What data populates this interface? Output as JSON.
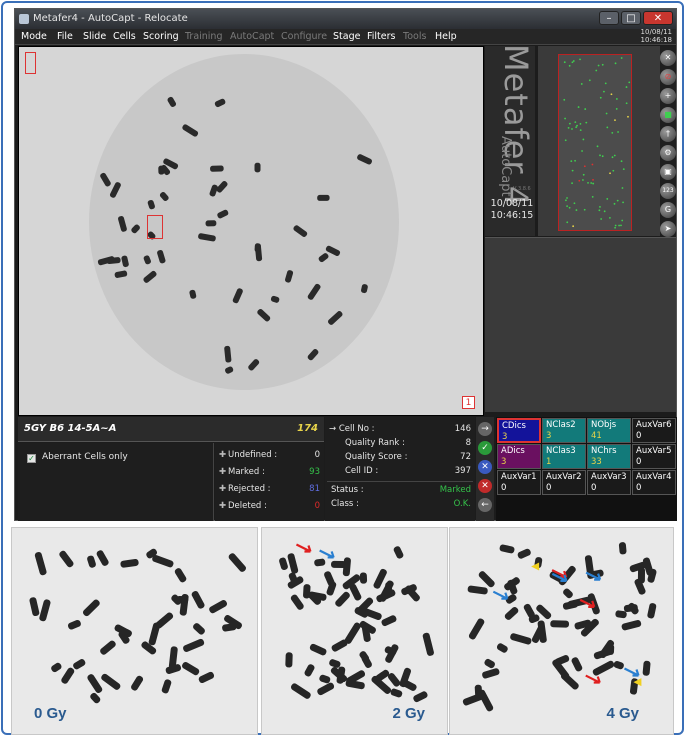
{
  "window": {
    "title": "Metafer4 - AutoCapt - Relocate",
    "clock_date": "10/08/11",
    "clock_time": "10:46:18"
  },
  "menu": [
    "Mode",
    "File",
    "Slide",
    "Cells",
    "Scoring",
    "Training",
    "AutoCapt",
    "Configure",
    "Stage",
    "Filters",
    "Tools",
    "Help"
  ],
  "menu_disabled": [
    "Training",
    "AutoCapt",
    "Configure",
    "Tools"
  ],
  "logo": {
    "name": "Metafer 4",
    "module": "AutoCapt",
    "version": "V 3.8.6",
    "date": "10/08/11",
    "time": "10:46:15"
  },
  "image": {
    "cell_index": "1"
  },
  "slide": {
    "name": "5GY B6 14-5A~A",
    "count": "174"
  },
  "filter": {
    "aberrant_only_label": "Aberrant Cells only",
    "aberrant_only_checked": true
  },
  "counts": [
    {
      "label": "Undefined :",
      "value": "0",
      "color": "#e6e6e6"
    },
    {
      "label": "Marked :",
      "value": "93",
      "color": "#35c24a"
    },
    {
      "label": "Rejected :",
      "value": "81",
      "color": "#5f6de0"
    },
    {
      "label": "Deleted :",
      "value": "0",
      "color": "#e02a2a"
    }
  ],
  "cell_info": {
    "cell_no_label": "Cell No :",
    "cell_no": "146",
    "quality_rank_label": "Quality Rank :",
    "quality_rank": "8",
    "quality_score_label": "Quality Score :",
    "quality_score": "72",
    "cell_id_label": "Cell ID :",
    "cell_id": "397",
    "status_label": "Status :",
    "status": "Marked",
    "class_label": "Class :",
    "class": "O.K."
  },
  "classifiers": [
    {
      "name": "CDics",
      "value": "3",
      "bg": "#13139a",
      "border": "#d33",
      "value_color": "#e8d44a"
    },
    {
      "name": "NClas2",
      "value": "3",
      "bg": "#127a7a",
      "border": "#555",
      "value_color": "#e8d44a"
    },
    {
      "name": "NObjs",
      "value": "41",
      "bg": "#127a7a",
      "border": "#555",
      "value_color": "#e8d44a"
    },
    {
      "name": "AuxVar6",
      "value": "0",
      "bg": "#1a1a1a",
      "border": "#555",
      "value_color": "#ffffff"
    },
    {
      "name": "ADics",
      "value": "3",
      "bg": "#6a1060",
      "border": "#555",
      "value_color": "#e8d44a"
    },
    {
      "name": "NClas3",
      "value": "1",
      "bg": "#127a7a",
      "border": "#555",
      "value_color": "#e8d44a"
    },
    {
      "name": "NChrs",
      "value": "33",
      "bg": "#127a7a",
      "border": "#555",
      "value_color": "#e8d44a"
    },
    {
      "name": "AuxVar5",
      "value": "0",
      "bg": "#1a1a1a",
      "border": "#555",
      "value_color": "#ffffff"
    },
    {
      "name": "AuxVar1",
      "value": "0",
      "bg": "#1a1a1a",
      "border": "#555",
      "value_color": "#ffffff"
    },
    {
      "name": "AuxVar2",
      "value": "0",
      "bg": "#1a1a1a",
      "border": "#555",
      "value_color": "#ffffff"
    },
    {
      "name": "AuxVar3",
      "value": "0",
      "bg": "#1a1a1a",
      "border": "#555",
      "value_color": "#ffffff"
    },
    {
      "name": "AuxVar4",
      "value": "0",
      "bg": "#1a1a1a",
      "border": "#555",
      "value_color": "#ffffff"
    }
  ],
  "toolbar_icons": [
    "close-icon",
    "no-entry-icon",
    "add-icon",
    "save-icon",
    "pin-icon",
    "stage-icon",
    "camera-icon",
    "counter-icon",
    "g-icon",
    "next-icon"
  ],
  "toolbar_text": {
    "counter": "123",
    "g": "G"
  },
  "nav_icons": [
    "next-arrow-icon",
    "accept-check-icon",
    "reject-x-icon",
    "delete-x-icon",
    "back-arrow-icon"
  ],
  "panels": [
    {
      "dose": "0 Gy",
      "marks": []
    },
    {
      "dose": "2 Gy",
      "marks": [
        "red-arrow",
        "blue-arrow"
      ]
    },
    {
      "dose": "4 Gy",
      "marks": [
        "red-arrow",
        "red-arrow",
        "red-arrow",
        "blue-arrow",
        "blue-arrow",
        "blue-arrow",
        "blue-arrow",
        "yellow-arrowhead",
        "yellow-arrowhead"
      ]
    }
  ]
}
